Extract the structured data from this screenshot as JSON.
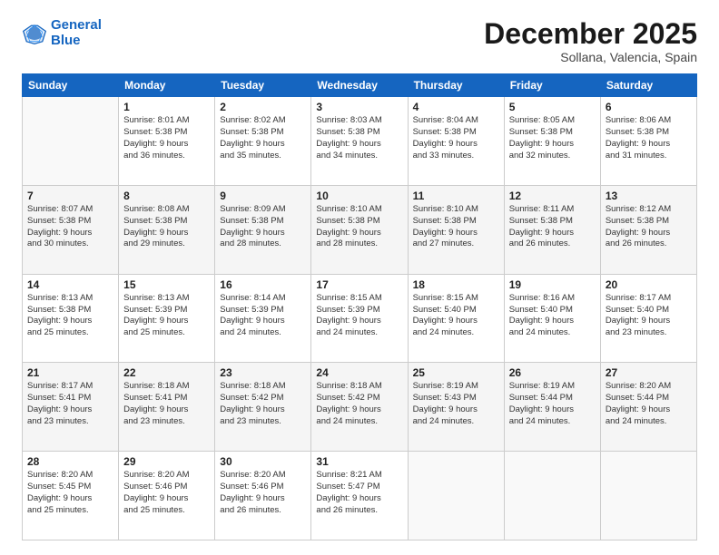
{
  "logo": {
    "line1": "General",
    "line2": "Blue"
  },
  "header": {
    "title": "December 2025",
    "subtitle": "Sollana, Valencia, Spain"
  },
  "weekdays": [
    "Sunday",
    "Monday",
    "Tuesday",
    "Wednesday",
    "Thursday",
    "Friday",
    "Saturday"
  ],
  "weeks": [
    [
      {
        "day": "",
        "info": ""
      },
      {
        "day": "1",
        "info": "Sunrise: 8:01 AM\nSunset: 5:38 PM\nDaylight: 9 hours\nand 36 minutes."
      },
      {
        "day": "2",
        "info": "Sunrise: 8:02 AM\nSunset: 5:38 PM\nDaylight: 9 hours\nand 35 minutes."
      },
      {
        "day": "3",
        "info": "Sunrise: 8:03 AM\nSunset: 5:38 PM\nDaylight: 9 hours\nand 34 minutes."
      },
      {
        "day": "4",
        "info": "Sunrise: 8:04 AM\nSunset: 5:38 PM\nDaylight: 9 hours\nand 33 minutes."
      },
      {
        "day": "5",
        "info": "Sunrise: 8:05 AM\nSunset: 5:38 PM\nDaylight: 9 hours\nand 32 minutes."
      },
      {
        "day": "6",
        "info": "Sunrise: 8:06 AM\nSunset: 5:38 PM\nDaylight: 9 hours\nand 31 minutes."
      }
    ],
    [
      {
        "day": "7",
        "info": "Sunrise: 8:07 AM\nSunset: 5:38 PM\nDaylight: 9 hours\nand 30 minutes."
      },
      {
        "day": "8",
        "info": "Sunrise: 8:08 AM\nSunset: 5:38 PM\nDaylight: 9 hours\nand 29 minutes."
      },
      {
        "day": "9",
        "info": "Sunrise: 8:09 AM\nSunset: 5:38 PM\nDaylight: 9 hours\nand 28 minutes."
      },
      {
        "day": "10",
        "info": "Sunrise: 8:10 AM\nSunset: 5:38 PM\nDaylight: 9 hours\nand 28 minutes."
      },
      {
        "day": "11",
        "info": "Sunrise: 8:10 AM\nSunset: 5:38 PM\nDaylight: 9 hours\nand 27 minutes."
      },
      {
        "day": "12",
        "info": "Sunrise: 8:11 AM\nSunset: 5:38 PM\nDaylight: 9 hours\nand 26 minutes."
      },
      {
        "day": "13",
        "info": "Sunrise: 8:12 AM\nSunset: 5:38 PM\nDaylight: 9 hours\nand 26 minutes."
      }
    ],
    [
      {
        "day": "14",
        "info": "Sunrise: 8:13 AM\nSunset: 5:38 PM\nDaylight: 9 hours\nand 25 minutes."
      },
      {
        "day": "15",
        "info": "Sunrise: 8:13 AM\nSunset: 5:39 PM\nDaylight: 9 hours\nand 25 minutes."
      },
      {
        "day": "16",
        "info": "Sunrise: 8:14 AM\nSunset: 5:39 PM\nDaylight: 9 hours\nand 24 minutes."
      },
      {
        "day": "17",
        "info": "Sunrise: 8:15 AM\nSunset: 5:39 PM\nDaylight: 9 hours\nand 24 minutes."
      },
      {
        "day": "18",
        "info": "Sunrise: 8:15 AM\nSunset: 5:40 PM\nDaylight: 9 hours\nand 24 minutes."
      },
      {
        "day": "19",
        "info": "Sunrise: 8:16 AM\nSunset: 5:40 PM\nDaylight: 9 hours\nand 24 minutes."
      },
      {
        "day": "20",
        "info": "Sunrise: 8:17 AM\nSunset: 5:40 PM\nDaylight: 9 hours\nand 23 minutes."
      }
    ],
    [
      {
        "day": "21",
        "info": "Sunrise: 8:17 AM\nSunset: 5:41 PM\nDaylight: 9 hours\nand 23 minutes."
      },
      {
        "day": "22",
        "info": "Sunrise: 8:18 AM\nSunset: 5:41 PM\nDaylight: 9 hours\nand 23 minutes."
      },
      {
        "day": "23",
        "info": "Sunrise: 8:18 AM\nSunset: 5:42 PM\nDaylight: 9 hours\nand 23 minutes."
      },
      {
        "day": "24",
        "info": "Sunrise: 8:18 AM\nSunset: 5:42 PM\nDaylight: 9 hours\nand 24 minutes."
      },
      {
        "day": "25",
        "info": "Sunrise: 8:19 AM\nSunset: 5:43 PM\nDaylight: 9 hours\nand 24 minutes."
      },
      {
        "day": "26",
        "info": "Sunrise: 8:19 AM\nSunset: 5:44 PM\nDaylight: 9 hours\nand 24 minutes."
      },
      {
        "day": "27",
        "info": "Sunrise: 8:20 AM\nSunset: 5:44 PM\nDaylight: 9 hours\nand 24 minutes."
      }
    ],
    [
      {
        "day": "28",
        "info": "Sunrise: 8:20 AM\nSunset: 5:45 PM\nDaylight: 9 hours\nand 25 minutes."
      },
      {
        "day": "29",
        "info": "Sunrise: 8:20 AM\nSunset: 5:46 PM\nDaylight: 9 hours\nand 25 minutes."
      },
      {
        "day": "30",
        "info": "Sunrise: 8:20 AM\nSunset: 5:46 PM\nDaylight: 9 hours\nand 26 minutes."
      },
      {
        "day": "31",
        "info": "Sunrise: 8:21 AM\nSunset: 5:47 PM\nDaylight: 9 hours\nand 26 minutes."
      },
      {
        "day": "",
        "info": ""
      },
      {
        "day": "",
        "info": ""
      },
      {
        "day": "",
        "info": ""
      }
    ]
  ]
}
